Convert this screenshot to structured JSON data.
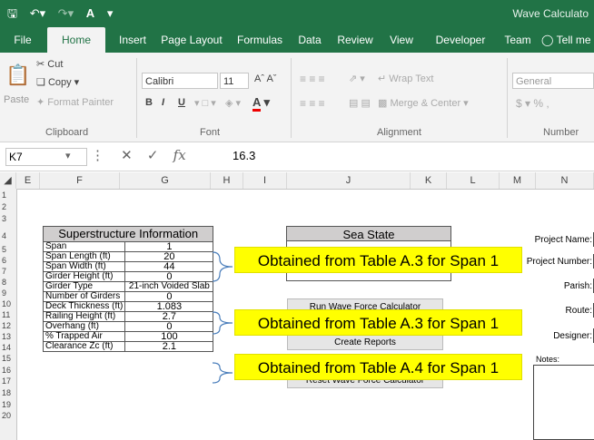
{
  "window": {
    "title": "Wave Calculato",
    "qat_icons": [
      "save-icon",
      "undo-icon",
      "redo-icon",
      "font-color-icon",
      "customize-icon"
    ]
  },
  "tabs": [
    "File",
    "Home",
    "Insert",
    "Page Layout",
    "Formulas",
    "Data",
    "Review",
    "View",
    "Developer",
    "Team",
    "Tell me"
  ],
  "active_tab": "Home",
  "ribbon": {
    "clipboard": {
      "cut": "Cut",
      "copy": "Copy",
      "paste": "Paste",
      "format_painter": "Format Painter",
      "label": "Clipboard"
    },
    "font": {
      "family": "Calibri",
      "size": "11",
      "label": "Font",
      "bold": "B",
      "italic": "I",
      "underline": "U"
    },
    "alignment": {
      "wrap": "Wrap Text",
      "merge": "Merge & Center",
      "label": "Alignment"
    },
    "number": {
      "format": "General",
      "currency": "$",
      "percent": "%",
      "comma": ",",
      "label": "Number"
    }
  },
  "formula_bar": {
    "name_box": "K7",
    "fx": "fx",
    "value": "16.3"
  },
  "columns": [
    "E",
    "F",
    "G",
    "H",
    "I",
    "J",
    "K",
    "L",
    "M",
    "N"
  ],
  "rows": [
    "1",
    "2",
    "3",
    "4",
    "5",
    "6",
    "7",
    "8",
    "9",
    "10",
    "11",
    "12",
    "13",
    "14",
    "15",
    "16",
    "17",
    "18",
    "19",
    "20"
  ],
  "superstructure": {
    "title": "Superstructure Information",
    "rows": [
      {
        "label": "Span",
        "value": "1"
      },
      {
        "label": "Span Length (ft)",
        "value": "20"
      },
      {
        "label": "Span Width (ft)",
        "value": "44"
      },
      {
        "label": "Girder Height (ft)",
        "value": "0"
      },
      {
        "label": "Girder Type",
        "value": "21-inch Voided Slab"
      },
      {
        "label": "Number of Girders",
        "value": "0"
      },
      {
        "label": "Deck Thickness (ft)",
        "value": "1.083"
      },
      {
        "label": "Railing Height (ft)",
        "value": "2.7"
      },
      {
        "label": "Overhang (ft)",
        "value": "0"
      },
      {
        "label": "% Trapped Air",
        "value": "100"
      },
      {
        "label": "Clearance Zc (ft)",
        "value": "2.1"
      }
    ]
  },
  "sea_state": {
    "title": "Sea State"
  },
  "buttons": {
    "run": "Run Wave Force Calculator",
    "create": "Create Reports",
    "reset": "Reset Wave Force Calculator"
  },
  "callouts": [
    "Obtained from Table A.3 for Span 1",
    "Obtained from Table A.3 for Span 1",
    "Obtained from Table A.4 for Span 1"
  ],
  "project_fields": [
    "Project Name:",
    "Project Number:",
    "Parish:",
    "Route:",
    "Designer:"
  ],
  "notes_label": "Notes:"
}
